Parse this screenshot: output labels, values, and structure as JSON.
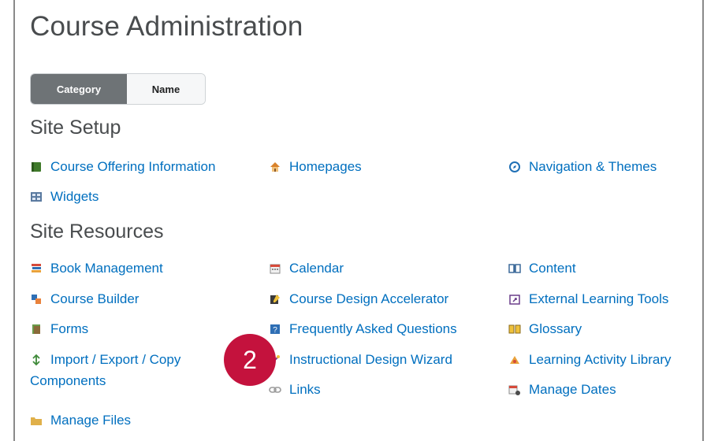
{
  "page": {
    "title": "Course Administration"
  },
  "view_toggle": {
    "category_label": "Category",
    "name_label": "Name",
    "selected": "Category"
  },
  "sections": {
    "site_setup": {
      "heading": "Site Setup",
      "items": {
        "course_offering_information": "Course Offering Information",
        "homepages": "Homepages",
        "navigation_themes": "Navigation & Themes",
        "widgets": "Widgets"
      }
    },
    "site_resources": {
      "heading": "Site Resources",
      "items": {
        "book_management": "Book Management",
        "calendar": "Calendar",
        "content": "Content",
        "course_builder": "Course Builder",
        "course_design_accelerator": "Course Design Accelerator",
        "external_learning_tools": "External Learning Tools",
        "forms": "Forms",
        "faq": "Frequently Asked Questions",
        "glossary": "Glossary",
        "import_export_copy_line1": "Import / Export / Copy",
        "import_export_copy_line2": "Components",
        "instructional_design_wizard": "Instructional Design Wizard",
        "learning_activity_library": "Learning Activity Library",
        "links": "Links",
        "manage_dates": "Manage Dates",
        "manage_files": "Manage Files"
      }
    }
  },
  "callout": {
    "number": "2",
    "color": "#c4123d"
  },
  "colors": {
    "link": "#006fbf",
    "heading": "#494c4e",
    "toggle_active": "#6e7376"
  },
  "icons": {
    "course_offering_information": "green-book-icon",
    "homepages": "house-icon",
    "navigation_themes": "compass-icon",
    "widgets": "widgets-grid-icon",
    "book_management": "books-icon",
    "calendar": "calendar-icon",
    "content": "open-book-icon",
    "course_builder": "blocks-icon",
    "course_design_accelerator": "pencil-folder-icon",
    "external_learning_tools": "external-tool-icon",
    "forms": "forms-icon",
    "faq": "faq-icon",
    "glossary": "glossary-book-icon",
    "import_export_copy": "arrows-icon",
    "instructional_design_wizard": "wizard-icon",
    "learning_activity_library": "activity-library-icon",
    "links": "chain-link-icon",
    "manage_dates": "calendar-gear-icon",
    "manage_files": "folder-icon"
  }
}
